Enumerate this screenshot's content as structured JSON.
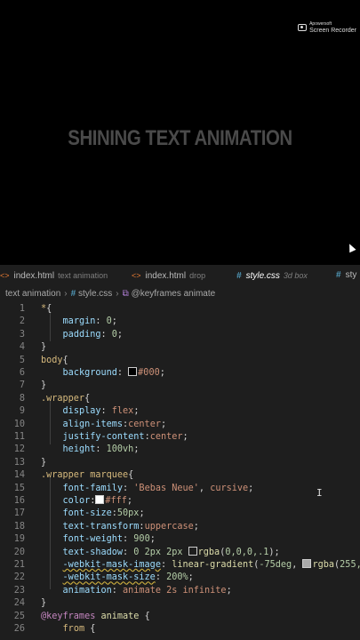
{
  "recorder": {
    "line1": "Apowersoft",
    "line2": "Screen Recorder"
  },
  "preview": {
    "headline": "SHINING TEXT ANIMATION"
  },
  "tabs": [
    {
      "file": "index.html",
      "desc": "text animation",
      "icon": "html-code-icon"
    },
    {
      "file": "index.html",
      "desc": "drop",
      "icon": "html-code-icon"
    },
    {
      "file": "style.css",
      "desc": "3d box",
      "icon": "css-hash-icon"
    },
    {
      "file": "sty",
      "desc": "",
      "icon": "css-hash-icon"
    }
  ],
  "breadcrumb": {
    "folder": "text animation",
    "file": "style.css",
    "symbol": "@keyframes animate"
  },
  "lines": [
    {
      "n": "1",
      "html": "<span class='t-sel'>*</span><span class='t-punc'>{</span>"
    },
    {
      "n": "2",
      "html": "    <span class='t-prop'>margin</span>: <span class='t-num'>0</span>;"
    },
    {
      "n": "3",
      "html": "    <span class='t-prop'>padding</span>: <span class='t-num'>0</span>;"
    },
    {
      "n": "4",
      "html": "<span class='t-punc'>}</span>"
    },
    {
      "n": "5",
      "html": "<span class='t-sel'>body</span><span class='t-punc'>{</span>"
    },
    {
      "n": "6",
      "html": "    <span class='t-prop'>background</span>: <span class='swatch' style='background:#000'></span><span class='t-val'>#000</span>;"
    },
    {
      "n": "7",
      "html": "<span class='t-punc'>}</span>"
    },
    {
      "n": "8",
      "html": "<span class='t-sel'>.wrapper</span><span class='t-punc'>{</span>"
    },
    {
      "n": "9",
      "html": "    <span class='t-prop'>display</span>: <span class='t-val'>flex</span>;"
    },
    {
      "n": "10",
      "html": "    <span class='t-prop'>align-items</span>:<span class='t-val'>center</span>;"
    },
    {
      "n": "11",
      "html": "    <span class='t-prop'>justify-content</span>:<span class='t-val'>center</span>;"
    },
    {
      "n": "12",
      "html": "    <span class='t-prop'>height</span>: <span class='t-num'>100vh</span>;"
    },
    {
      "n": "13",
      "html": "<span class='t-punc'>}</span>"
    },
    {
      "n": "14",
      "html": "<span class='t-sel'>.wrapper marquee</span><span class='t-punc'>{</span>"
    },
    {
      "n": "15",
      "html": "    <span class='t-prop'>font-family</span>: <span class='t-val'>'Bebas Neue'</span>, <span class='t-val'>cursive</span>;"
    },
    {
      "n": "16",
      "html": "    <span class='t-prop'>color</span>:<span class='swatch' style='background:#fff'></span><span class='t-val'>#fff</span>;"
    },
    {
      "n": "17",
      "html": "    <span class='t-prop'>font-size</span>:<span class='t-num'>50px</span>;"
    },
    {
      "n": "18",
      "html": "    <span class='t-prop'>text-transform</span>:<span class='t-val'>uppercase</span>;"
    },
    {
      "n": "19",
      "html": "    <span class='t-prop'>font-weight</span>: <span class='t-num'>900</span>;"
    },
    {
      "n": "20",
      "html": "    <span class='t-prop'>text-shadow</span>: <span class='t-num'>0 2px 2px</span> <span class='swatch' style='background:#1e1e1e'></span><span class='t-kw'>rgba</span>(<span class='t-num'>0,0,0,.1</span>);"
    },
    {
      "n": "21",
      "html": "    <span class='t-prop squig'>-webkit-mask-image</span>: <span class='t-kw'>linear-gradient</span>(<span class='t-num'>-75deg</span>, <span class='swatch' style='background:#aaa'></span><span class='t-kw'>rgba</span>(<span class='t-num'>255,25</span>"
    },
    {
      "n": "22",
      "html": "    <span class='t-prop squig'>-webkit-mask-size</span>: <span class='t-num'>200%</span>;"
    },
    {
      "n": "23",
      "html": "    <span class='t-prop'>animation</span>: <span class='t-val'>animate 2s infinite</span>;"
    },
    {
      "n": "24",
      "html": "<span class='t-punc'>}</span>"
    },
    {
      "n": "25",
      "html": "<span class='t-at'>@keyframes</span> <span class='t-kw'>animate</span> <span class='t-punc'>{</span>"
    },
    {
      "n": "26",
      "html": "    <span class='t-sel'>from</span> <span class='t-punc'>{</span>"
    }
  ]
}
